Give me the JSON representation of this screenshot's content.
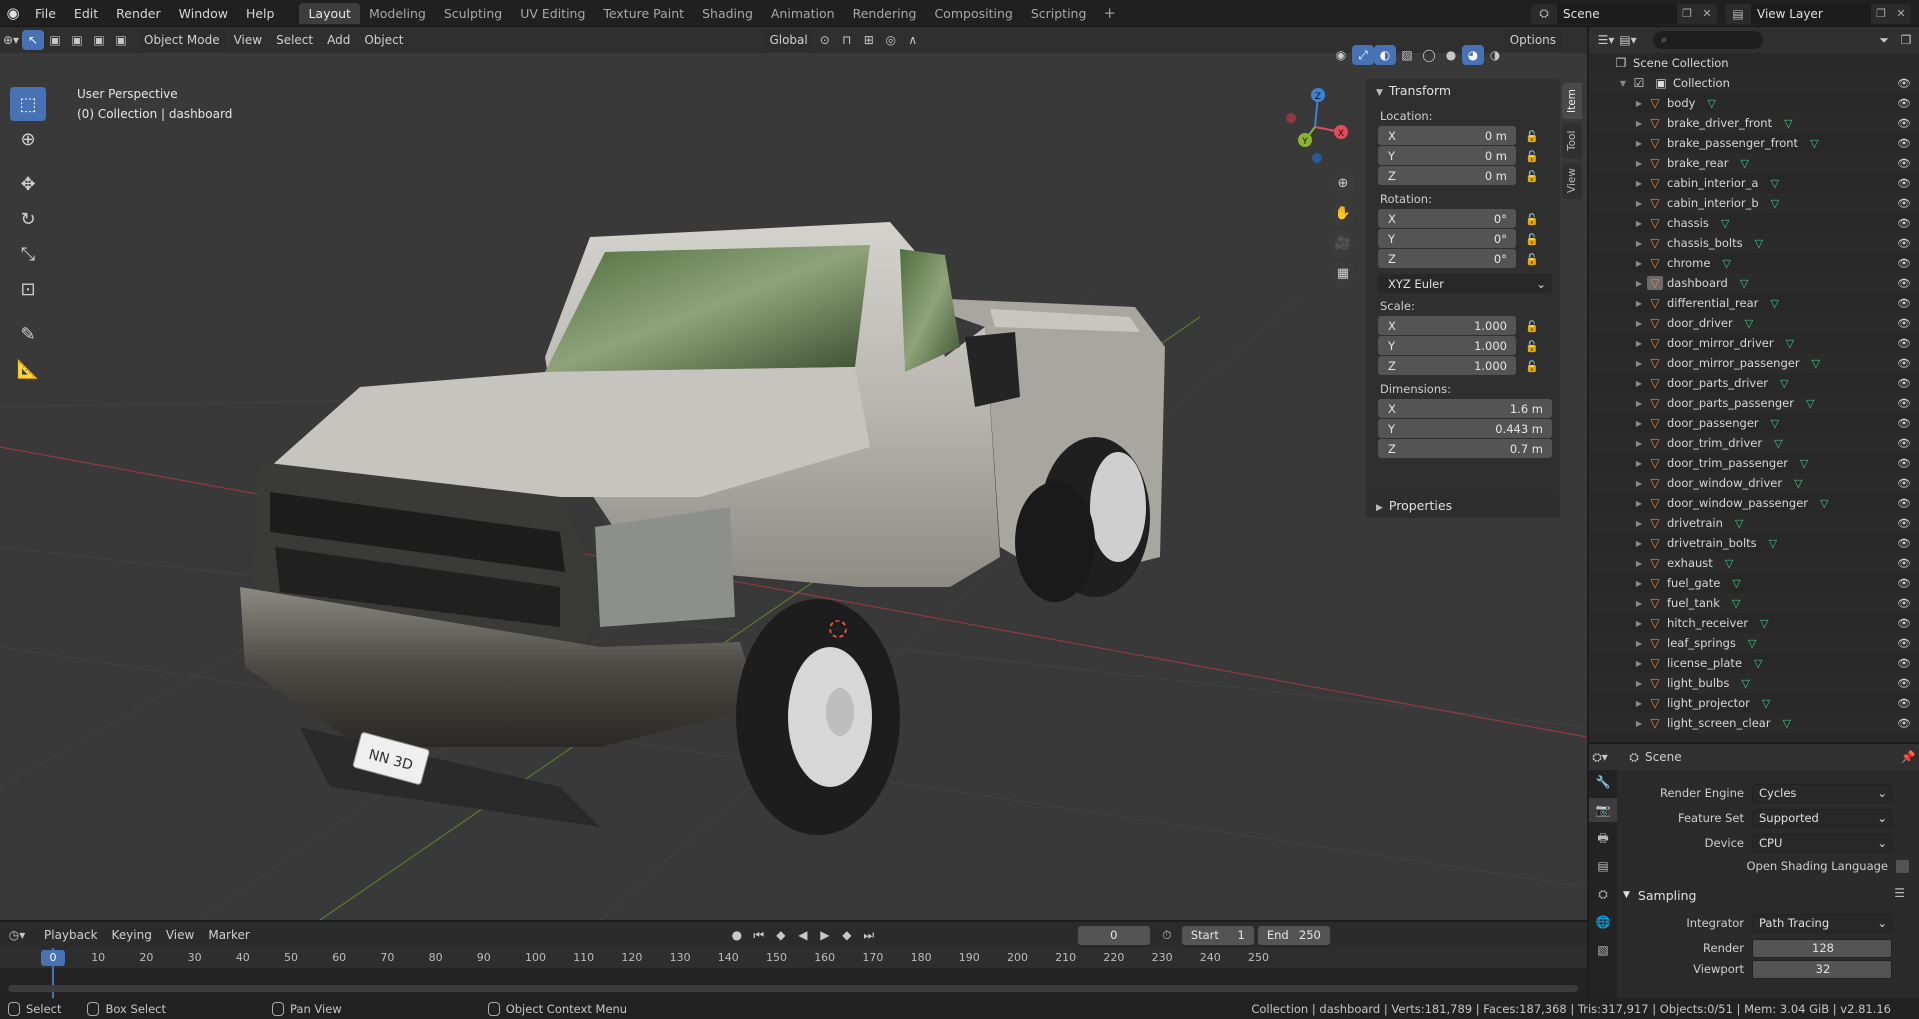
{
  "topbar": {
    "menus": [
      "File",
      "Edit",
      "Render",
      "Window",
      "Help"
    ],
    "workspaces": [
      "Layout",
      "Modeling",
      "Sculpting",
      "UV Editing",
      "Texture Paint",
      "Shading",
      "Animation",
      "Rendering",
      "Compositing",
      "Scripting"
    ],
    "active_workspace": "Layout",
    "scene": "Scene",
    "view_layer": "View Layer"
  },
  "viewport": {
    "mode": "Object Mode",
    "menus": [
      "View",
      "Select",
      "Add",
      "Object"
    ],
    "transform_orientation": "Global",
    "options_label": "Options",
    "info_line1": "User Perspective",
    "info_line2": "(0) Collection | dashboard",
    "license_plate": "NN 3D"
  },
  "npanel": {
    "transform_title": "Transform",
    "location_label": "Location:",
    "location": {
      "x": "0 m",
      "y": "0 m",
      "z": "0 m"
    },
    "rotation_label": "Rotation:",
    "rotation": {
      "x": "0°",
      "y": "0°",
      "z": "0°"
    },
    "rotation_mode": "XYZ Euler",
    "scale_label": "Scale:",
    "scale": {
      "x": "1.000",
      "y": "1.000",
      "z": "1.000"
    },
    "dimensions_label": "Dimensions:",
    "dimensions": {
      "x": "1.6 m",
      "y": "0.443 m",
      "z": "0.7 m"
    },
    "axis_x": "X",
    "axis_y": "Y",
    "axis_z": "Z",
    "properties_title": "Properties",
    "tabs": [
      "Item",
      "Tool",
      "View"
    ]
  },
  "outliner": {
    "root": "Scene Collection",
    "collection": "Collection",
    "items": [
      "body",
      "brake_driver_front",
      "brake_passenger_front",
      "brake_rear",
      "cabin_interior_a",
      "cabin_interior_b",
      "chassis",
      "chassis_bolts",
      "chrome",
      "dashboard",
      "differential_rear",
      "door_driver",
      "door_mirror_driver",
      "door_mirror_passenger",
      "door_parts_driver",
      "door_parts_passenger",
      "door_passenger",
      "door_trim_driver",
      "door_trim_passenger",
      "door_window_driver",
      "door_window_passenger",
      "drivetrain",
      "drivetrain_bolts",
      "exhaust",
      "fuel_gate",
      "fuel_tank",
      "hitch_receiver",
      "leaf_springs",
      "license_plate",
      "light_bulbs",
      "light_projector",
      "light_screen_clear"
    ],
    "selected": "dashboard"
  },
  "properties": {
    "context": "Scene",
    "render_engine_label": "Render Engine",
    "render_engine": "Cycles",
    "feature_set_label": "Feature Set",
    "feature_set": "Supported",
    "device_label": "Device",
    "device": "CPU",
    "osl_label": "Open Shading Language",
    "sampling_title": "Sampling",
    "integrator_label": "Integrator",
    "integrator": "Path Tracing",
    "render_label": "Render",
    "render_samples": "128",
    "viewport_label": "Viewport",
    "viewport_samples": "32"
  },
  "timeline": {
    "menus": [
      "Playback",
      "Keying",
      "View",
      "Marker"
    ],
    "current_frame": "0",
    "start_label": "Start",
    "start": "1",
    "end_label": "End",
    "end": "250",
    "ticks": [
      "0",
      "10",
      "20",
      "30",
      "40",
      "50",
      "60",
      "70",
      "80",
      "90",
      "100",
      "110",
      "120",
      "130",
      "140",
      "150",
      "160",
      "170",
      "180",
      "190",
      "200",
      "210",
      "220",
      "230",
      "240",
      "250"
    ]
  },
  "statusbar": {
    "select": "Select",
    "box_select": "Box Select",
    "pan_view": "Pan View",
    "context_menu": "Object Context Menu",
    "stats": "Collection | dashboard | Verts:181,789 | Faces:187,368 | Tris:317,917 | Objects:0/51 | Mem: 3.04 GiB | v2.81.16"
  },
  "colors": {
    "accent": "#4772b3",
    "object_icon": "#e88a3c",
    "mesh_icon": "#44c58a",
    "axis_x": "#e24c5b",
    "axis_y": "#8ab62f",
    "axis_z": "#3e82d6"
  }
}
